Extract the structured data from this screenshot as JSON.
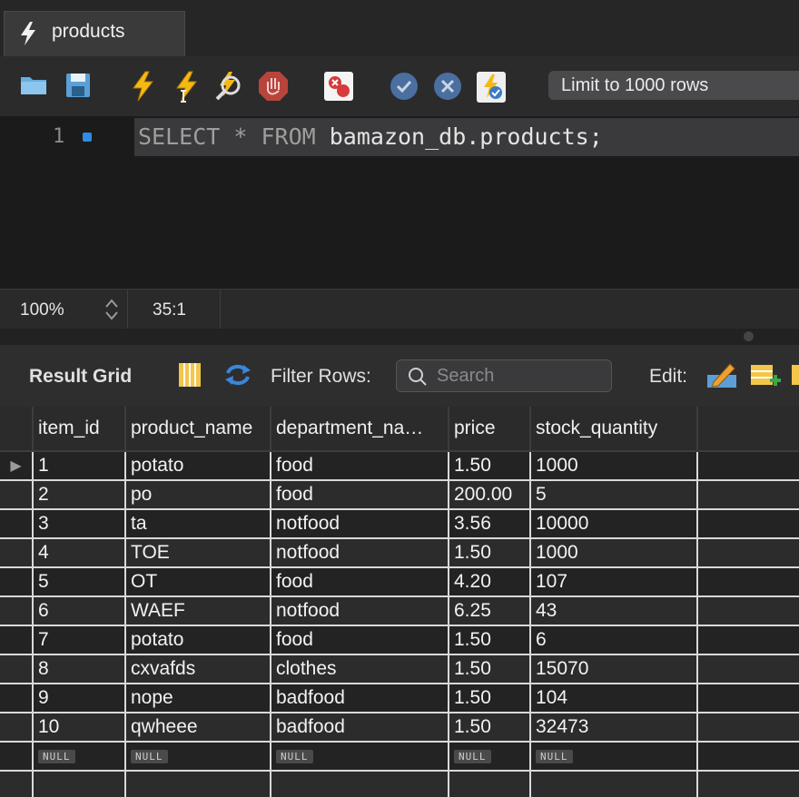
{
  "tab": {
    "title": "products"
  },
  "toolbar": {
    "icons": [
      "open-folder-icon",
      "save-icon",
      "execute-icon",
      "execute-current-icon",
      "explain-icon",
      "stop-icon",
      "toggle-error-icon",
      "commit-icon",
      "rollback-icon",
      "autocommit-icon"
    ],
    "limit_label": "Limit to 1000 rows"
  },
  "editor": {
    "line_number": "1",
    "code": {
      "kw1": "SELECT",
      "star": " * ",
      "kw2": "FROM",
      "rest": " bamazon_db.products;"
    }
  },
  "status": {
    "zoom": "100%",
    "cursor": "35:1"
  },
  "result": {
    "label": "Result Grid",
    "filter_label": "Filter Rows:",
    "search_placeholder": "Search",
    "edit_label": "Edit:",
    "columns": [
      "item_id",
      "product_name",
      "department_na…",
      "price",
      "stock_quantity"
    ],
    "rows": [
      [
        "1",
        "potato",
        "food",
        "1.50",
        "1000"
      ],
      [
        "2",
        "po",
        "food",
        "200.00",
        "5"
      ],
      [
        "3",
        "ta",
        "notfood",
        "3.56",
        "10000"
      ],
      [
        "4",
        "TOE",
        "notfood",
        "1.50",
        "1000"
      ],
      [
        "5",
        "OT",
        "food",
        "4.20",
        "107"
      ],
      [
        "6",
        "WAEF",
        "notfood",
        "6.25",
        "43"
      ],
      [
        "7",
        "potato",
        "food",
        "1.50",
        "6"
      ],
      [
        "8",
        "cxvafds",
        "clothes",
        "1.50",
        "15070"
      ],
      [
        "9",
        "nope",
        "badfood",
        "1.50",
        "104"
      ],
      [
        "10",
        "qwheee",
        "badfood",
        "1.50",
        "32473"
      ]
    ],
    "null_label": "NULL",
    "current_row_marker": "▶"
  },
  "colors": {
    "accent": "#2f8ce0",
    "background": "#1e1e1f",
    "grid_line": "#d9d9d9"
  }
}
